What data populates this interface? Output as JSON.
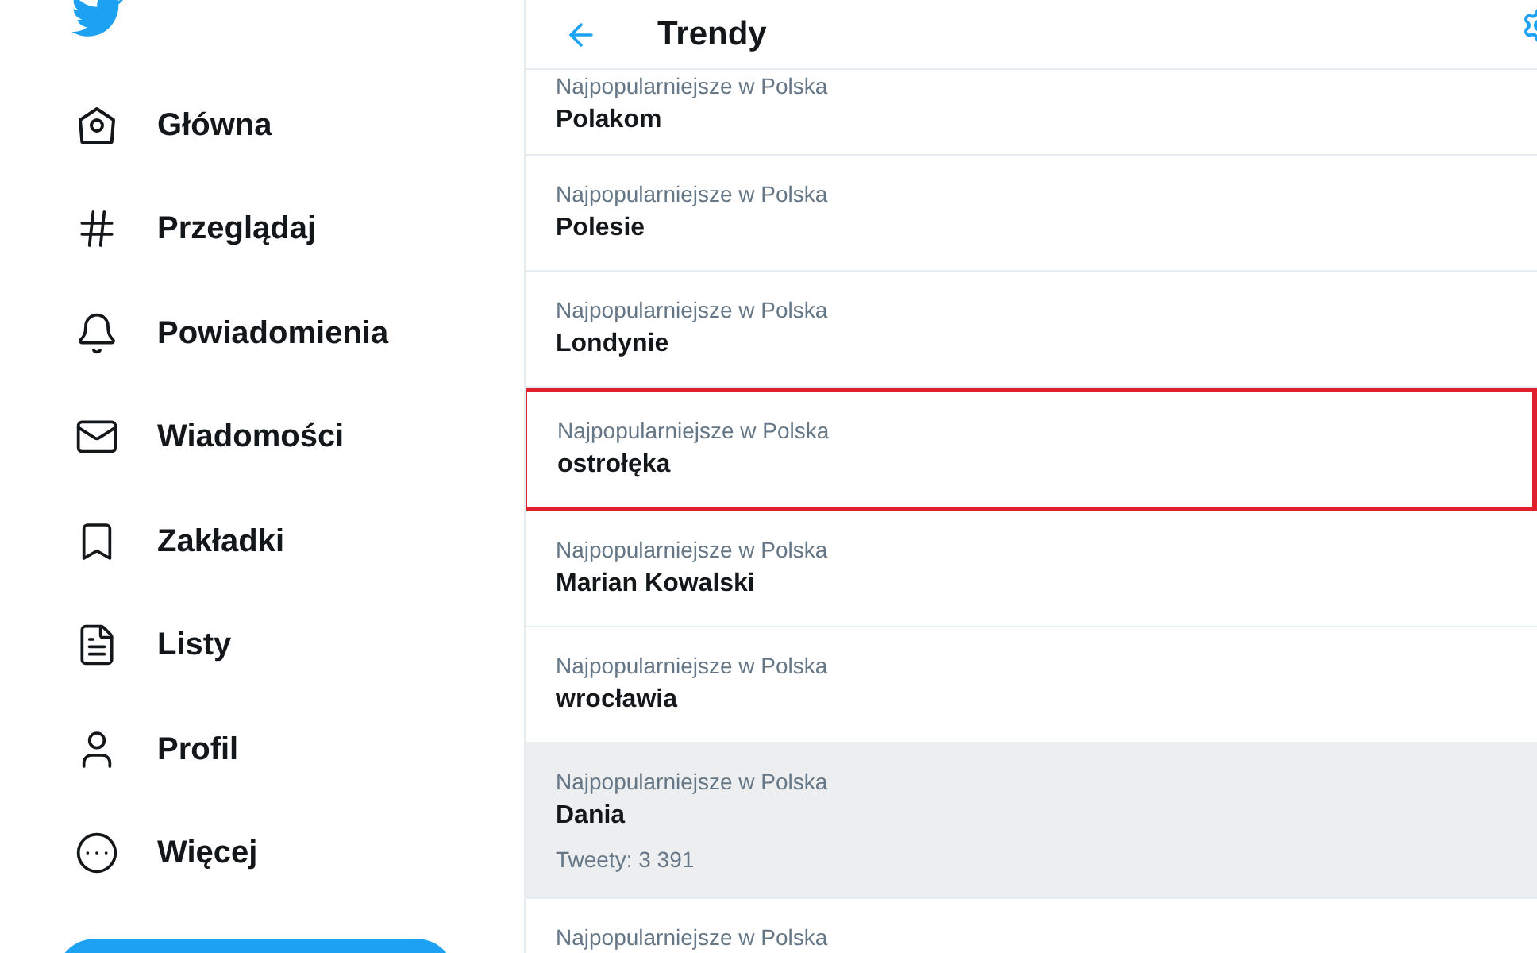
{
  "sidebar": {
    "items": [
      {
        "kind": "home",
        "label": "Główna"
      },
      {
        "kind": "explore",
        "label": "Przeglądaj"
      },
      {
        "kind": "notifications",
        "label": "Powiadomienia"
      },
      {
        "kind": "messages",
        "label": "Wiadomości"
      },
      {
        "kind": "bookmarks",
        "label": "Zakładki"
      },
      {
        "kind": "lists",
        "label": "Listy"
      },
      {
        "kind": "profile",
        "label": "Profil"
      },
      {
        "kind": "more",
        "label": "Więcej"
      }
    ]
  },
  "header": {
    "title": "Trendy"
  },
  "trends": [
    {
      "context": "Najpopularniejsze w Polska",
      "title": "Polakom",
      "highlighted": false,
      "hovered": false
    },
    {
      "context": "Najpopularniejsze w Polska",
      "title": "Polesie",
      "highlighted": false,
      "hovered": false
    },
    {
      "context": "Najpopularniejsze w Polska",
      "title": "Londynie",
      "highlighted": false,
      "hovered": false
    },
    {
      "context": "Najpopularniejsze w Polska",
      "title": "ostrołęka",
      "highlighted": true,
      "hovered": false
    },
    {
      "context": "Najpopularniejsze w Polska",
      "title": "Marian Kowalski",
      "highlighted": false,
      "hovered": false
    },
    {
      "context": "Najpopularniejsze w Polska",
      "title": "wrocławia",
      "highlighted": false,
      "hovered": false
    },
    {
      "context": "Najpopularniejsze w Polska",
      "title": "Dania",
      "count": "Tweety: 3 391",
      "highlighted": false,
      "hovered": true
    },
    {
      "context": "Najpopularniejsze w Polska",
      "highlighted": false,
      "hovered": false
    }
  ]
}
